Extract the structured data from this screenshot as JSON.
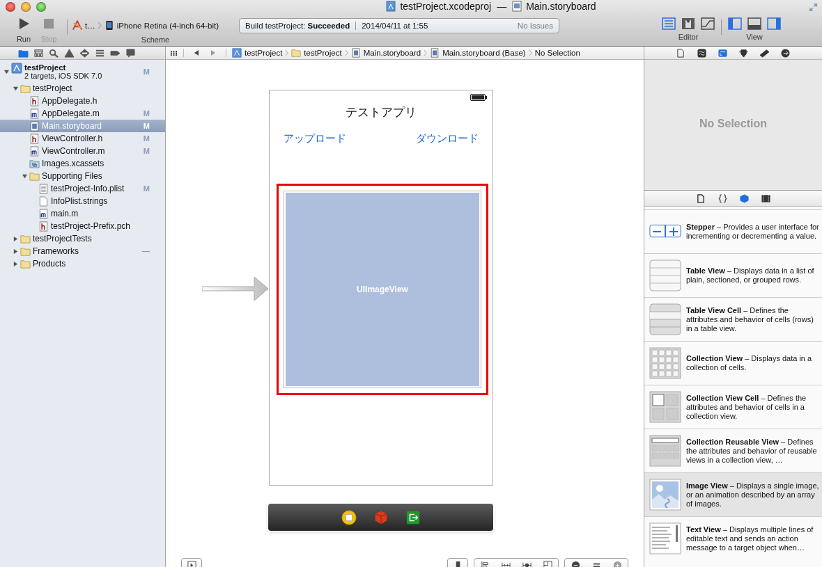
{
  "window": {
    "title_project": "testProject.xcodeproj",
    "title_separator": "—",
    "title_file": "Main.storyboard"
  },
  "toolbar": {
    "run": {
      "label": "Run",
      "disabled": false
    },
    "stop": {
      "label": "Stop",
      "disabled": true
    },
    "scheme": {
      "target": "t…",
      "device": "iPhone Retina (4-inch 64-bit)",
      "label": "Scheme"
    },
    "activity": {
      "status": "Build testProject: **Succeeded**",
      "time": "2014/04/11 at 1:55",
      "issues": "No Issues"
    },
    "editor": {
      "label": "Editor",
      "modes": [
        {
          "kind": "standard",
          "selected": true
        },
        {
          "kind": "assistant",
          "selected": false
        },
        {
          "kind": "version",
          "selected": false
        }
      ]
    },
    "view": {
      "label": "View",
      "panels": [
        {
          "kind": "left",
          "selected": true
        },
        {
          "kind": "bottom",
          "selected": false
        },
        {
          "kind": "right",
          "selected": true
        }
      ]
    }
  },
  "navigator": {
    "tabs": [
      {
        "kind": "folder",
        "selected": true
      },
      {
        "kind": "hierarchy",
        "selected": false
      },
      {
        "kind": "search",
        "selected": false
      },
      {
        "kind": "warning",
        "selected": false
      },
      {
        "kind": "breakpoint",
        "selected": false
      },
      {
        "kind": "list",
        "selected": false
      },
      {
        "kind": "tag",
        "selected": false
      },
      {
        "kind": "bubble",
        "selected": false
      }
    ],
    "tree": [
      {
        "name": "testProject",
        "subtitle": "2 targets, iOS SDK 7.0",
        "kind": "project",
        "badge": "M",
        "selected": false,
        "expanded": true,
        "children": [
          {
            "name": "testProject",
            "kind": "folder",
            "selected": false,
            "expanded": true,
            "children": [
              {
                "name": "AppDelegate.h",
                "kind": "h",
                "selected": false
              },
              {
                "name": "AppDelegate.m",
                "kind": "m",
                "badge": "M",
                "selected": false
              },
              {
                "name": "Main.storyboard",
                "kind": "storyboard",
                "badge": "M",
                "selected": true
              },
              {
                "name": "ViewController.h",
                "kind": "h",
                "badge": "M",
                "selected": false
              },
              {
                "name": "ViewController.m",
                "kind": "m",
                "badge": "M",
                "selected": false
              },
              {
                "name": "Images.xcassets",
                "kind": "xcassets",
                "selected": false
              },
              {
                "name": "Supporting Files",
                "kind": "folder",
                "selected": false,
                "expanded": true,
                "children": [
                  {
                    "name": "testProject-Info.plist",
                    "kind": "plist",
                    "badge": "M",
                    "selected": false
                  },
                  {
                    "name": "InfoPlist.strings",
                    "kind": "strings",
                    "selected": false
                  },
                  {
                    "name": "main.m",
                    "kind": "m",
                    "selected": false
                  },
                  {
                    "name": "testProject-Prefix.pch",
                    "kind": "h",
                    "selected": false
                  }
                ]
              }
            ]
          },
          {
            "name": "testProjectTests",
            "kind": "folder",
            "selected": false,
            "expanded": false
          },
          {
            "name": "Frameworks",
            "kind": "folder",
            "badge": "—",
            "selected": false,
            "expanded": false
          },
          {
            "name": "Products",
            "kind": "folder",
            "selected": false,
            "expanded": false
          }
        ]
      }
    ]
  },
  "jump_bar": [
    {
      "name": "testProject",
      "kind": "project"
    },
    {
      "name": "testProject",
      "kind": "folder"
    },
    {
      "name": "Main.storyboard",
      "kind": "storyboard"
    },
    {
      "name": "Main.storyboard (Base)",
      "kind": "storyboard"
    },
    {
      "name": "No Selection",
      "kind": "none"
    }
  ],
  "scene": {
    "title": "テストアプリ",
    "buttons": [
      "アップロード",
      "ダウンロード"
    ],
    "image_view": {
      "label": "UIImageView",
      "highlighted": true
    }
  },
  "inspector": {
    "tabs": [
      {
        "kind": "file",
        "selected": false
      },
      {
        "kind": "help",
        "selected": false
      },
      {
        "kind": "attributes",
        "selected": true
      },
      {
        "kind": "size",
        "selected": false
      },
      {
        "kind": "ruler",
        "selected": false
      },
      {
        "kind": "connections",
        "selected": false
      }
    ],
    "empty_text": "No Selection"
  },
  "library": {
    "tabs": [
      {
        "kind": "file",
        "selected": false
      },
      {
        "kind": "braces",
        "selected": false
      },
      {
        "kind": "cube",
        "selected": true
      },
      {
        "kind": "film",
        "selected": false
      }
    ],
    "items": [
      {
        "kind": "stepper",
        "text": "**Stepper** – Provides a user interface for incrementing or decrementing a value.",
        "selected": false
      },
      {
        "kind": "table",
        "text": "**Table View** – Displays data in a list of plain, sectioned, or grouped rows.",
        "selected": false
      },
      {
        "kind": "table-cell",
        "text": "**Table View Cell** – Defines the attributes and behavior of cells (rows) in a table view.",
        "selected": false
      },
      {
        "kind": "collection",
        "text": "**Collection View** – Displays data in a collection of cells.",
        "selected": false
      },
      {
        "kind": "collection-cell",
        "text": "**Collection View Cell** – Defines the attributes and behavior of cells in a collection view.",
        "selected": false
      },
      {
        "kind": "reusable",
        "text": "**Collection Reusable View** – Defines the attributes and behavior of reusable views in a collection view, …",
        "selected": false
      },
      {
        "kind": "image",
        "text": "**Image View** – Displays a single image, or an animation described by an array of images.",
        "selected": true
      },
      {
        "kind": "text",
        "text": "**Text View** – Displays multiple lines of editable text and sends an action message to a target object when…",
        "selected": false
      }
    ]
  }
}
